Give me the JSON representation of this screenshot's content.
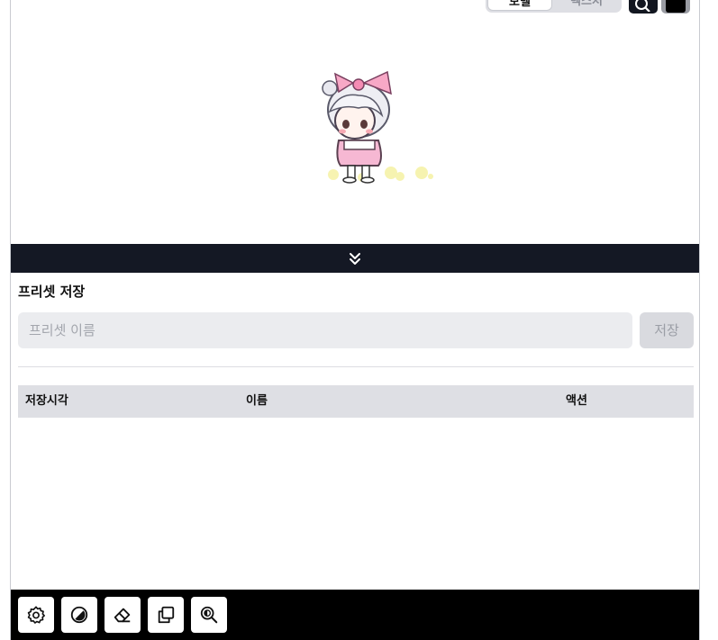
{
  "viewer": {
    "mode_tabs": [
      "모델",
      "텍스처"
    ],
    "character_icon": "character-sprite"
  },
  "collapse": {
    "icon": "double-chevron-down-icon"
  },
  "preset": {
    "title": "프리셋 저장",
    "input_placeholder": "프리셋 이름",
    "input_value": "",
    "save_label": "저장"
  },
  "table": {
    "headers": [
      "저장시각",
      "이름",
      "액션"
    ],
    "rows": []
  },
  "toolbar": {
    "icons": [
      "settings-icon",
      "contrast-icon",
      "eraser-icon",
      "copy-icon",
      "zoom-icon"
    ]
  },
  "colors": {
    "dark_bar": "#141824",
    "toolbar": "#000000",
    "input_bg": "#ebecef",
    "header_bg": "#dedfe4"
  }
}
